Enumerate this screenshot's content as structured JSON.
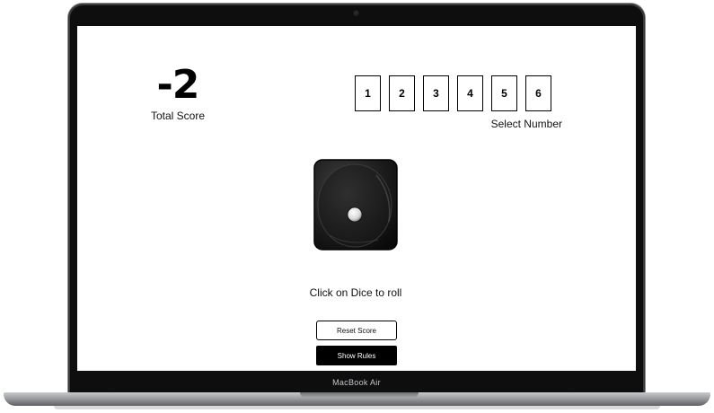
{
  "device": {
    "brand_label": "MacBook Air"
  },
  "game": {
    "total_score": "-2",
    "total_score_label": "Total Score",
    "numbers": [
      "1",
      "2",
      "3",
      "4",
      "5",
      "6"
    ],
    "select_number_label": "Select Number",
    "dice_face": 1,
    "roll_hint": "Click on Dice to roll",
    "reset_button": "Reset Score",
    "rules_button": "Show Rules"
  },
  "colors": {
    "frame": "#0e0e0f",
    "screen_bg": "#ffffff",
    "primary": "#000000",
    "button_text_dark": "#ffffff"
  }
}
